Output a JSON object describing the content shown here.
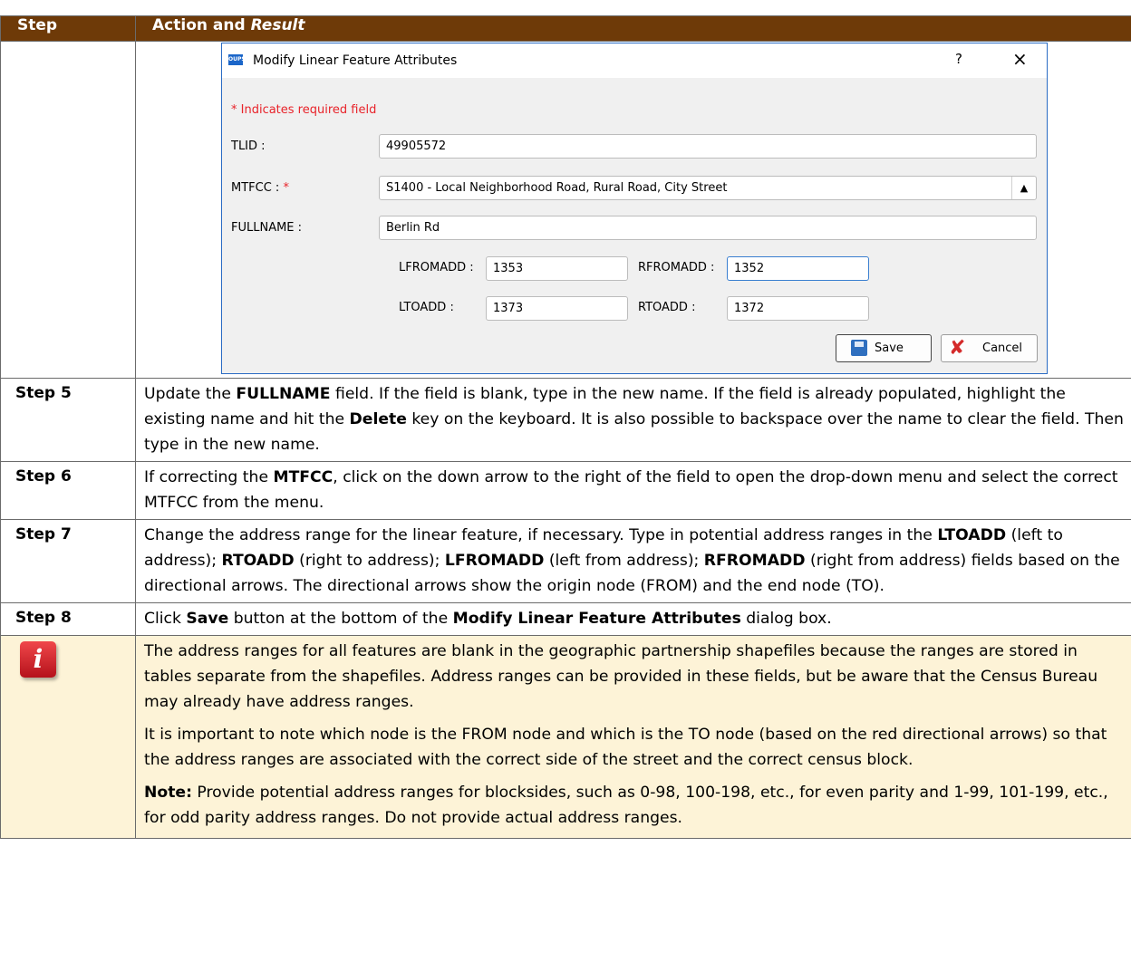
{
  "header": {
    "col_step": "Step",
    "col_action": "Action and ",
    "col_result": "Result"
  },
  "dialog": {
    "icon_text": "OUPS",
    "title": "Modify Linear Feature Attributes",
    "help": "?",
    "close": "×",
    "required_note": "* Indicates required field",
    "tlid_label": "TLID :",
    "tlid_value": "49905572",
    "mtfcc_label": "MTFCC : ",
    "mtfcc_star": "*",
    "mtfcc_value": "S1400 - Local Neighborhood Road, Rural Road, City Street",
    "fullname_label": "FULLNAME :",
    "fullname_value": "Berlin Rd",
    "lfromadd_label": "LFROMADD :",
    "lfromadd_value": "1353",
    "rfromadd_label": "RFROMADD :",
    "rfromadd_value": "1352",
    "ltoadd_label": "LTOADD :",
    "ltoadd_value": "1373",
    "rtoadd_label": "RTOADD :",
    "rtoadd_value": "1372",
    "save_label": "Save",
    "cancel_label": "Cancel"
  },
  "steps": [
    {
      "label": "Step 5"
    },
    {
      "label": "Step 6"
    },
    {
      "label": "Step 7"
    },
    {
      "label": "Step 8"
    }
  ],
  "step5": {
    "t1": "Update the ",
    "b1": "FULLNAME",
    "t2": " field. If the field is blank, type in the new name. If the field is already populated, highlight the existing name and hit the ",
    "b2": "Delete",
    "t3": " key on the keyboard. It is also possible to backspace over the name to clear the field. Then type in the new name."
  },
  "step6": {
    "t1": "If correcting the ",
    "b1": "MTFCC",
    "t2": ", click on the down arrow to the right of the field to open the drop-down menu and select the correct MTFCC from the menu."
  },
  "step7": {
    "t1": "Change the address range for the linear feature, if necessary. Type in potential address ranges in the ",
    "b1": "LTOADD",
    "t2": " (left to address); ",
    "b2": "RTOADD",
    "t3": " (right to address); ",
    "b3": "LFROMADD",
    "t4": " (left from address); ",
    "b4": "RFROMADD",
    "t5": " (right from address) fields based on the directional arrows. The directional arrows show the origin node (FROM) and the end node (TO)."
  },
  "step8": {
    "t1": "Click ",
    "b1": "Save",
    "t2": " button at the bottom of the ",
    "b2": "Modify Linear Feature Attributes",
    "t3": " dialog box."
  },
  "note": {
    "icon": "i",
    "p1": "The address ranges for all features are blank in the geographic partnership shapefiles because the ranges are stored in tables separate from the shapefiles. Address ranges can be provided in these fields, but be aware that the Census Bureau may already have address ranges.",
    "p2": "It is important to note which node is the FROM node and which is the TO node (based on the red directional arrows) so that the address ranges are associated with the correct side of the street and the correct census block.",
    "p3_bold": "Note:",
    "p3": "  Provide potential address ranges for blocksides, such as 0-98, 100-198, etc., for even parity and 1-99, 101-199, etc., for odd parity address ranges. Do not provide actual address ranges."
  },
  "colors": {
    "header_bg": "#6e3a08",
    "note_bg": "#fdf3d7",
    "required_red": "#e8232a",
    "dialog_border": "#2b6cc4"
  }
}
